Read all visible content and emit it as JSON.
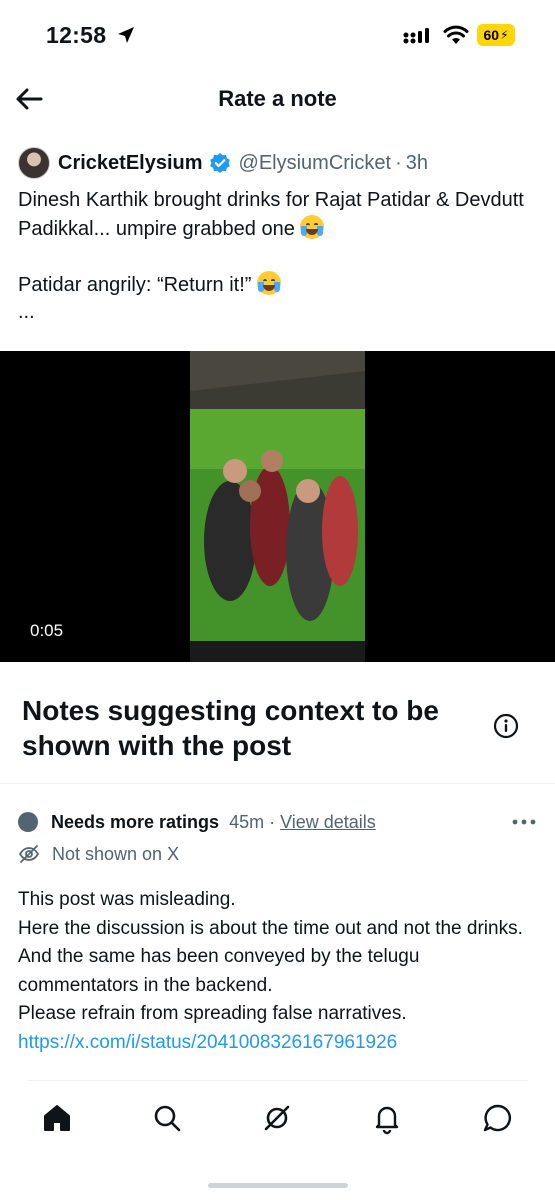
{
  "status_bar": {
    "time": "12:58",
    "battery": "60"
  },
  "header": {
    "title": "Rate a note"
  },
  "tweet": {
    "display_name": "CricketElysium",
    "handle": "@ElysiumCricket",
    "separator": "·",
    "age": "3h",
    "line1": "Dinesh Karthik brought drinks for Rajat Patidar & Devdutt Padikkal... umpire grabbed one",
    "line2": "Patidar angrily: “Return it!”",
    "ellipsis": "...",
    "video_duration": "0:05"
  },
  "notes_section": {
    "title": "Notes suggesting context to be shown with the post"
  },
  "note": {
    "status": "Needs more ratings",
    "age": "45m",
    "separator": "·",
    "view_details": "View details",
    "visibility": "Not shown on X",
    "body_lines": [
      "This post was misleading.",
      "Here the discussion is about the time out and not the drinks. And the same has been conveyed by the telugu commentators in the backend.",
      "Please refrain from spreading false narratives."
    ],
    "link": "https://x.com/i/status/2041008326167961926"
  },
  "tab_bar": {
    "tabs": [
      "home-icon",
      "search-icon",
      "community-notes-icon",
      "notifications-icon",
      "messages-icon"
    ]
  },
  "colors": {
    "link_blue": "#1d9bf0",
    "secondary_text": "#536471",
    "verified_blue": "#1d9bf0",
    "battery_yellow": "#ffd60a"
  }
}
